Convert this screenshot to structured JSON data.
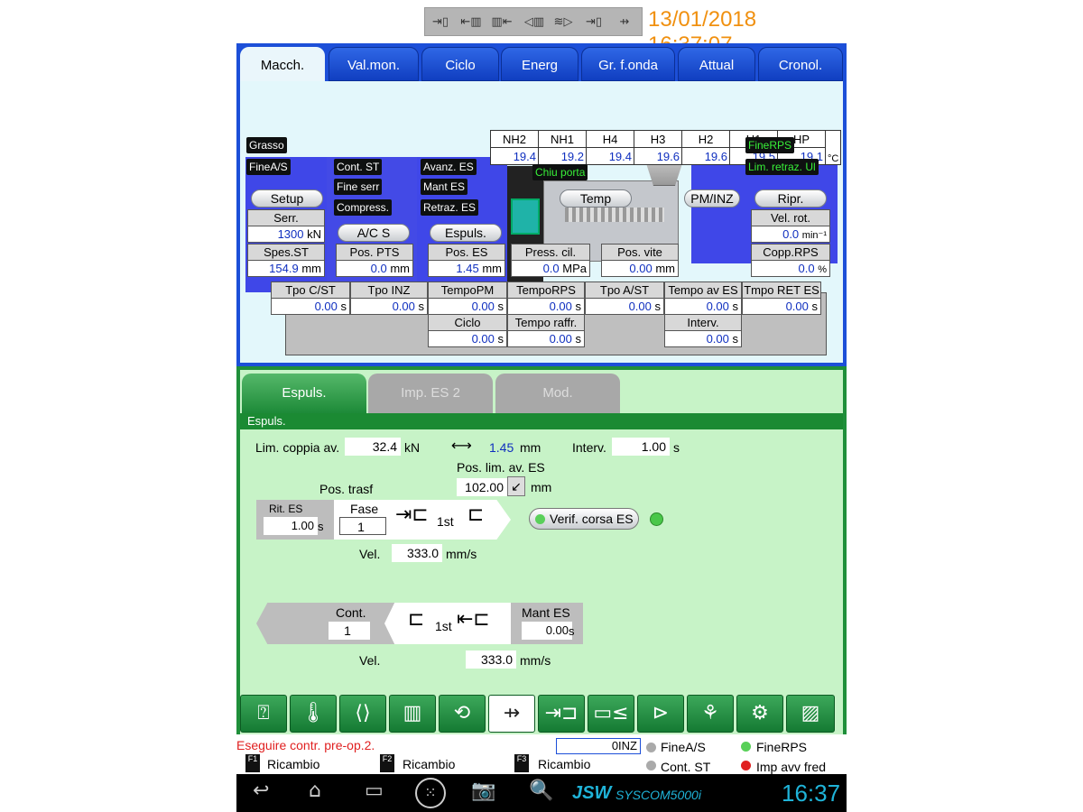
{
  "header": {
    "status_icons": [
      "clamp-close-icon",
      "mold-open-icon",
      "mold-close-icon",
      "eject-icon",
      "nozzle-icon",
      "core-icon",
      "ejector-icon"
    ],
    "datetime": "13/01/2018 16:37:07"
  },
  "tabs": [
    "Macch.",
    "Val.mon.",
    "Ciclo",
    "Energ",
    "Gr. f.onda",
    "Attual",
    "Cronol."
  ],
  "temps": {
    "headers": [
      "NH2",
      "NH1",
      "H4",
      "H3",
      "H2",
      "H1",
      "HP"
    ],
    "values": [
      "19.4",
      "19.2",
      "19.4",
      "19.6",
      "19.6",
      "19.5",
      "19.1"
    ],
    "unit": "°C"
  },
  "tags": {
    "grasso": "Grasso",
    "finea_s": "FineA/S",
    "cont_st": "Cont. ST",
    "fine_serr": "Fine serr",
    "compress": "Compress.",
    "avanz_es": "Avanz. ES",
    "mant_es": "Mant ES",
    "retraz_es": "Retraz. ES",
    "chiu_porta": "Chiu porta",
    "finerps": "FineRPS",
    "lim_retraz": "Lim. retraz. Ul"
  },
  "pills": {
    "setup": "Setup",
    "acs": "A/C S",
    "espuls": "Espuls.",
    "temp": "Temp",
    "pminz": "PM/INZ",
    "ripr": "Ripr."
  },
  "machine": {
    "serr_label": "Serr.",
    "serr_value": "1300",
    "serr_unit": "kN",
    "spes_label": "Spes.ST",
    "spes_value": "154.9",
    "spes_unit": "mm",
    "pospts_label": "Pos. PTS",
    "pospts_value": "0.0",
    "pospts_unit": "mm",
    "poses_label": "Pos. ES",
    "poses_value": "1.45",
    "poses_unit": "mm",
    "presscil_label": "Press. cil.",
    "presscil_value": "0.0",
    "presscil_unit": "MPa",
    "posvite_label": "Pos. vite",
    "posvite_value": "0.00",
    "posvite_unit": "mm",
    "velrot_label": "Vel. rot.",
    "velrot_value": "0.0",
    "velrot_unit": "min⁻¹",
    "copprps_label": "Copp.RPS",
    "copprps_value": "0.0",
    "copprps_unit": "%"
  },
  "times": {
    "headers": [
      "Tpo C/ST",
      "Tpo INZ",
      "TempoPM",
      "TempoRPS",
      "Tpo A/ST",
      "Tempo av ES",
      "Tmpo RET ES"
    ],
    "values": [
      "0.00",
      "0.00",
      "0.00",
      "0.00",
      "0.00",
      "0.00",
      "0.00"
    ],
    "unit": "s",
    "ciclo_label": "Ciclo",
    "ciclo_value": "0.00",
    "raffr_label": "Tempo raffr.",
    "raffr_value": "0.00",
    "interv_label": "Interv.",
    "interv_value": "0.00"
  },
  "lower_tabs": [
    "Espuls.",
    "Imp. ES 2",
    "Mod."
  ],
  "section_title": "Espuls.",
  "form": {
    "lim_coppia_label": "Lim. coppia av.",
    "lim_coppia_value": "32.4",
    "lim_coppia_unit": "kN",
    "pos_value": "1.45",
    "pos_unit": "mm",
    "interv_label": "Interv.",
    "interv_value": "1.00",
    "interv_unit": "s",
    "pos_lim_label": "Pos. lim. av. ES",
    "pos_lim_value": "102.00",
    "pos_lim_unit": "mm",
    "pos_trasf_label": "Pos. trasf",
    "rit_es_label": "Rit. ES",
    "rit_es_value": "1.00",
    "rit_es_unit": "s",
    "fase_label": "Fase",
    "fase_value": "1",
    "first_stage": "1st",
    "verif_label": "Verif. corsa ES",
    "vel_label": "Vel.",
    "vel_value": "333.0",
    "vel_unit": "mm/s",
    "cont_label": "Cont.",
    "cont_value": "1",
    "mant_label": "Mant ES",
    "mant_value": "0.00",
    "mant_unit": "s",
    "vel2_label": "Vel.",
    "vel2_value": "333.0",
    "vel2_unit": "mm/s"
  },
  "toolbar": [
    "mold-icon",
    "thermometer-icon",
    "mold-close-icon",
    "mold-open-icon",
    "screw-icon",
    "ejector-icon",
    "core-icon",
    "nozzle-icon",
    "injection-icon",
    "robot-icon",
    "settings-icon",
    "clamp-icon"
  ],
  "footer": {
    "message": "Eseguire contr. pre-op.2.",
    "inz_value": "0INZ",
    "finea_s": "FineA/S",
    "finerps": "FineRPS",
    "cont_st": "Cont. ST",
    "imp_avv": "Imp avv fred",
    "f1": "Ricambio",
    "f2": "Ricambio",
    "f3": "Ricambio",
    "f1_key": "F1",
    "f2_key": "F2",
    "f3_key": "F3"
  },
  "navbar": {
    "brand": "JSW",
    "brand_sub": "SYSCOM5000i",
    "time": "16:37"
  }
}
